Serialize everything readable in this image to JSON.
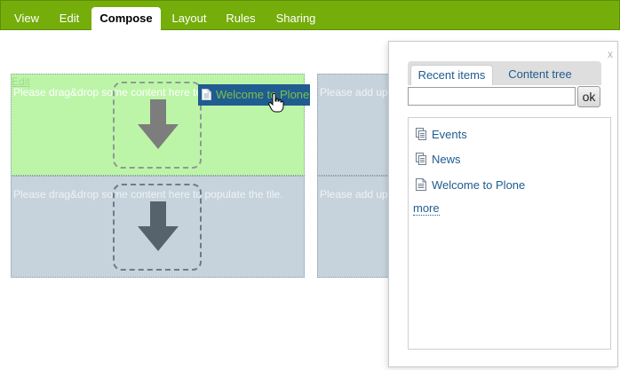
{
  "toolbar": {
    "tabs": [
      {
        "label": "View"
      },
      {
        "label": "Edit"
      },
      {
        "label": "Compose"
      },
      {
        "label": "Layout"
      },
      {
        "label": "Rules"
      },
      {
        "label": "Sharing"
      }
    ],
    "active_tab": "Compose"
  },
  "tiles": {
    "top_left": {
      "edit_link": "Edit",
      "message": "Please drag&drop some content here to populate the tile."
    },
    "top_right": {
      "message": "Please add up"
    },
    "bottom_left": {
      "message": "Please drag&drop some content here to populate the tile."
    },
    "bottom_right": {
      "message": "Please add up"
    }
  },
  "drag_item": {
    "label": "Welcome to Plone",
    "icon": "document-icon"
  },
  "panel": {
    "close_label": "x",
    "tabs": [
      {
        "label": "Recent items"
      },
      {
        "label": "Content tree"
      }
    ],
    "search": {
      "value": "",
      "placeholder": ""
    },
    "ok_label": "ok",
    "items": [
      {
        "label": "Events",
        "icon": "collection-icon"
      },
      {
        "label": "News",
        "icon": "collection-icon"
      },
      {
        "label": "Welcome to Plone",
        "icon": "document-icon"
      }
    ],
    "more_label": "more"
  },
  "colors": {
    "toolbar_green": "#75ad0a",
    "link_blue": "#205c90",
    "tile_gray": "#c6d3dd",
    "tile_green": "#bdf5a8",
    "drag_bg": "#205c90"
  }
}
